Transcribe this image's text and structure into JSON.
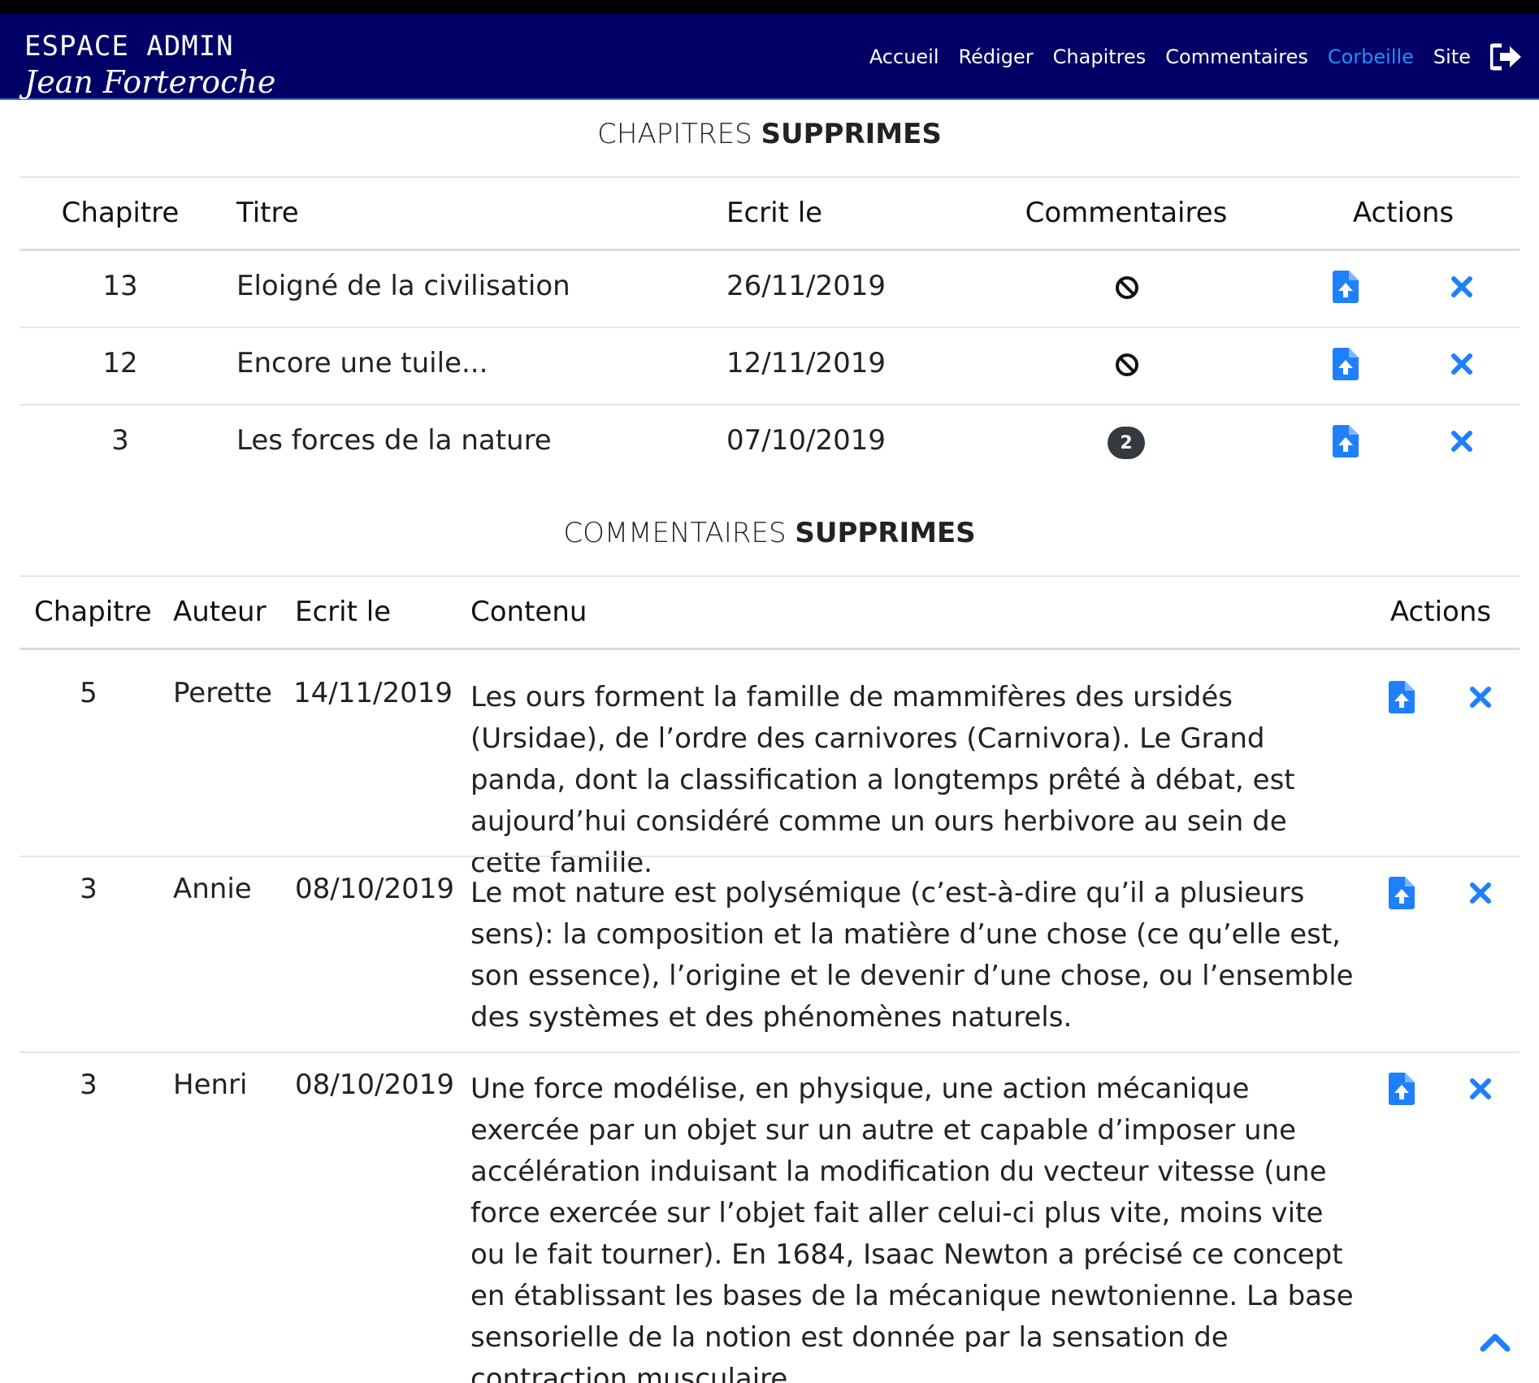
{
  "brand": {
    "title": "ESPACE ADMIN",
    "signature": "Jean Forteroche"
  },
  "nav": {
    "items": [
      "Accueil",
      "Rédiger",
      "Chapitres",
      "Commentaires",
      "Corbeille",
      "Site"
    ],
    "active": "Corbeille"
  },
  "colors": {
    "navbar": "#000066",
    "accent": "#1e90ff",
    "badge": "#343a40"
  },
  "chapters": {
    "title_light": "CHAPITRES",
    "title_bold": "SUPPRIMES",
    "headers": {
      "chapter": "Chapitre",
      "title": "Titre",
      "date": "Ecrit le",
      "comments": "Commentaires",
      "actions": "Actions"
    },
    "rows": [
      {
        "chapter": "13",
        "title": "Eloigné de la civilisation",
        "date": "26/11/2019",
        "comments": "none",
        "comment_count": ""
      },
      {
        "chapter": "12",
        "title": "Encore une tuile...",
        "date": "12/11/2019",
        "comments": "none",
        "comment_count": ""
      },
      {
        "chapter": "3",
        "title": "Les forces de la nature",
        "date": "07/10/2019",
        "comments": "badge",
        "comment_count": "2"
      }
    ]
  },
  "comments": {
    "title_light": "COMMENTAIRES",
    "title_bold": "SUPPRIMES",
    "headers": {
      "chapter": "Chapitre",
      "author": "Auteur",
      "date": "Ecrit le",
      "content": "Contenu",
      "actions": "Actions"
    },
    "rows": [
      {
        "chapter": "5",
        "author": "Perette",
        "date": "14/11/2019",
        "content": "Les ours forment la famille de mammifères des ursidés (Ursidae), de l’ordre des carnivores (Carnivora). Le Grand panda, dont la classification a longtemps prêté à débat, est aujourd’hui considéré comme un ours herbivore au sein de cette famille."
      },
      {
        "chapter": "3",
        "author": "Annie",
        "date": "08/10/2019",
        "content": "Le mot nature est polysémique (c’est-à-dire qu’il a plusieurs sens): la composition et la matière d’une chose (ce qu’elle est, son essence), l’origine et le devenir d’une chose, ou l’ensemble des systèmes et des phénomènes naturels."
      },
      {
        "chapter": "3",
        "author": "Henri",
        "date": "08/10/2019",
        "content": "Une force modélise, en physique, une action mécanique exercée par un objet sur un autre et capable d’imposer une accélération induisant la modification du vecteur vitesse (une force exercée sur l’objet fait aller celui-ci plus vite, moins vite ou le fait tourner). En 1684, Isaac Newton a précisé ce concept en établissant les bases de la mécanique newtonienne. La base sensorielle de la notion est donnée par la sensation de contraction musculaire."
      }
    ]
  },
  "icons": {
    "restore": "file-upload-icon",
    "delete": "close-icon",
    "no_comments": "ban-icon",
    "logout": "sign-out-icon",
    "scroll_top": "chevron-up-icon"
  }
}
